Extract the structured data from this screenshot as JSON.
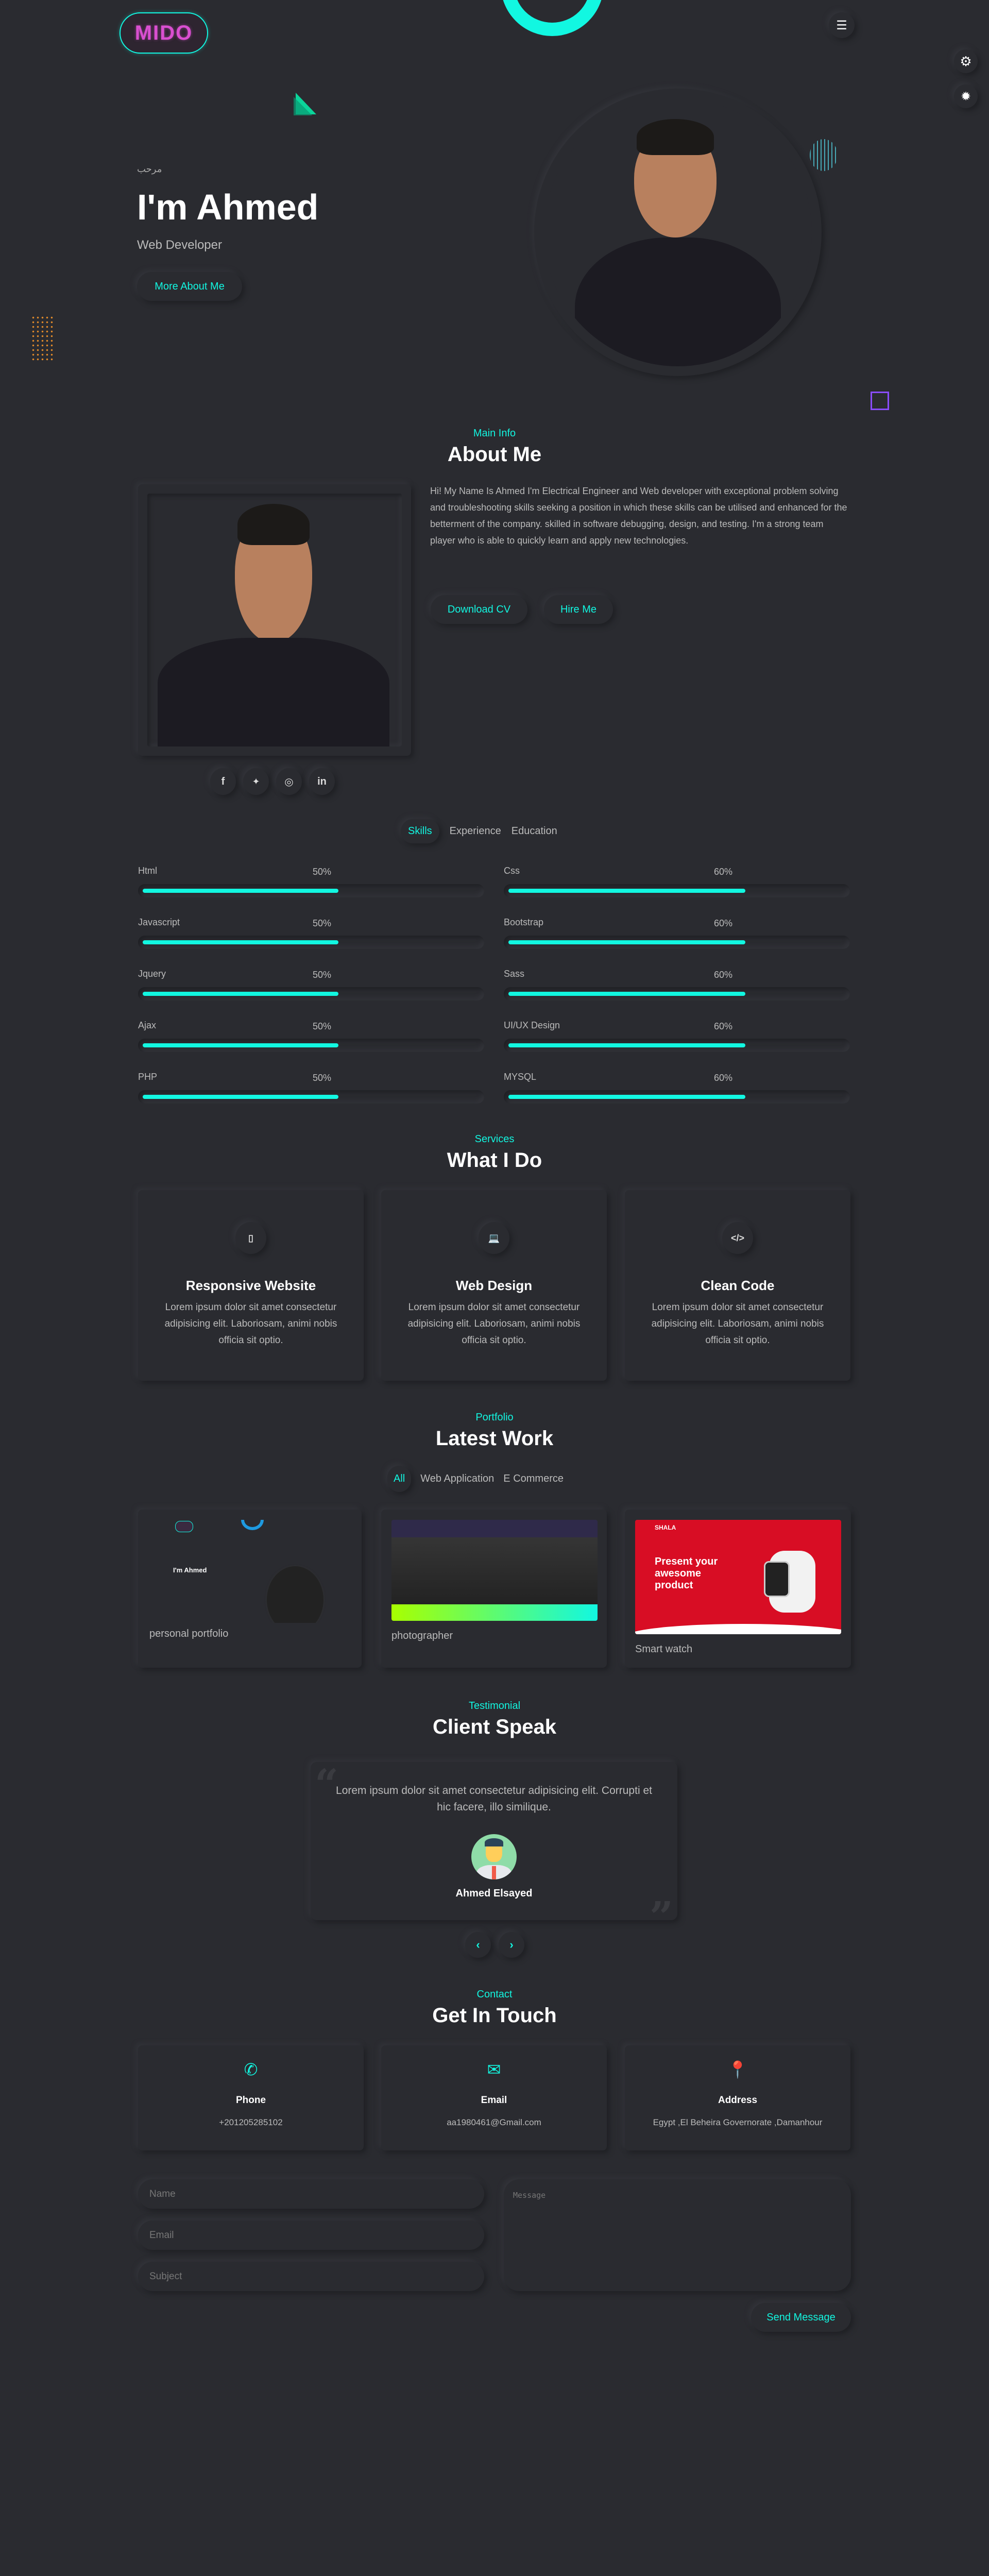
{
  "colors": {
    "background": "#2a2b30",
    "accent": "#12f7e1",
    "logo": "#d94fd0",
    "purple": "#8a4dff"
  },
  "header": {
    "logo": "MIDO",
    "menu_icon": "hamburger-icon",
    "settings_icon": "gear-icon",
    "theme_icon": "sun-icon"
  },
  "hero": {
    "greeting": "مرحب",
    "title": "I'm Ahmed",
    "subtitle": "Web Developer",
    "button": "More About Me"
  },
  "about": {
    "label": "Main Info",
    "title": "About Me",
    "text": "Hi! My Name Is Ahmed I'm Electrical Engineer and Web developer with exceptional problem solving and troubleshooting skills seeking a position in which these skills can be utilised and enhanced for the betterment of the company. skilled in software debugging, design, and testing. I'm a strong team player who is able to quickly learn and apply new technologies.",
    "download_cv": "Download CV",
    "hire_me": "Hire Me",
    "socials": [
      {
        "name": "facebook",
        "glyph": "f"
      },
      {
        "name": "twitter",
        "glyph": "🐦"
      },
      {
        "name": "instagram",
        "glyph": "◎"
      },
      {
        "name": "linkedin",
        "glyph": "in"
      }
    ],
    "tabs": [
      "Skills",
      "Experience",
      "Education"
    ],
    "active_tab": "Skills"
  },
  "skills": [
    {
      "name": "Html",
      "percent": 50
    },
    {
      "name": "Css",
      "percent": 60
    },
    {
      "name": "Javascript",
      "percent": 50
    },
    {
      "name": "Bootstrap",
      "percent": 60
    },
    {
      "name": "Jquery",
      "percent": 50
    },
    {
      "name": "Sass",
      "percent": 60
    },
    {
      "name": "Ajax",
      "percent": 50
    },
    {
      "name": "UI/UX Design",
      "percent": 60
    },
    {
      "name": "PHP",
      "percent": 50
    },
    {
      "name": "MYSQL",
      "percent": 60
    }
  ],
  "services": {
    "label": "Services",
    "title": "What I Do",
    "items": [
      {
        "icon": "mobile-icon",
        "title": "Responsive Website",
        "text": "Lorem ipsum dolor sit amet consectetur adipisicing elit. Laboriosam, animi nobis officia sit optio."
      },
      {
        "icon": "laptop-code-icon",
        "title": "Web Design",
        "text": "Lorem ipsum dolor sit amet consectetur adipisicing elit. Laboriosam, animi nobis officia sit optio."
      },
      {
        "icon": "code-icon",
        "title": "Clean Code",
        "text": "Lorem ipsum dolor sit amet consectetur adipisicing elit. Laboriosam, animi nobis officia sit optio."
      }
    ]
  },
  "portfolio": {
    "label": "Portfolio",
    "title": "Latest Work",
    "filters": [
      "All",
      "Web Application",
      "E Commerce"
    ],
    "active_filter": "All",
    "items": [
      {
        "title": "personal portfolio"
      },
      {
        "title": "photographer"
      },
      {
        "title": "Smart watch",
        "brand": "SHALA",
        "headline": "Present your awesome product"
      }
    ]
  },
  "testimonial": {
    "label": "Testimonial",
    "title": "Client Speak",
    "quote": "Lorem ipsum dolor sit amet consectetur adipisicing elit. Corrupti et hic facere, illo similique.",
    "name": "Ahmed Elsayed"
  },
  "contact": {
    "label": "Contact",
    "title": "Get In Touch",
    "cards": [
      {
        "icon": "phone-icon",
        "title": "Phone",
        "value": "+201205285102"
      },
      {
        "icon": "envelope-icon",
        "title": "Email",
        "value": "aa1980461@Gmail.com"
      },
      {
        "icon": "map-marker-icon",
        "title": "Address",
        "value": "Egypt ,El Beheira Governorate ,Damanhour"
      }
    ],
    "form": {
      "name_placeholder": "Name",
      "email_placeholder": "Email",
      "subject_placeholder": "Subject",
      "message_placeholder": "Message",
      "submit": "Send Message"
    }
  }
}
